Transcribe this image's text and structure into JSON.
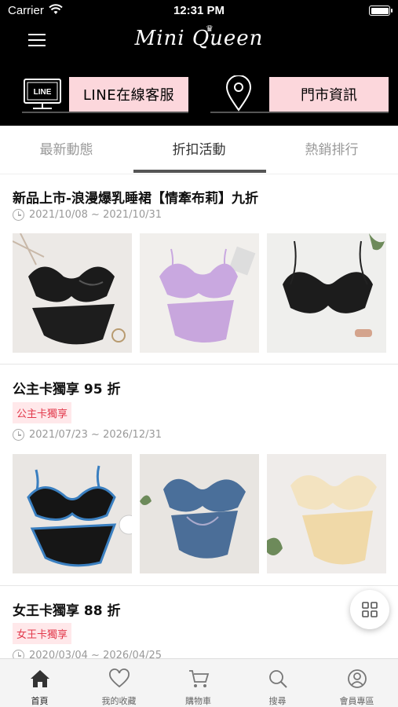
{
  "status_bar": {
    "carrier": "Carrier",
    "time": "12:31 PM"
  },
  "header": {
    "logo": "Mini Queen",
    "line_button": "LINE在線客服",
    "store_button": "門市資訊",
    "tv_label": "LINE"
  },
  "tabs": [
    {
      "label": "最新動態",
      "active": false
    },
    {
      "label": "折扣活動",
      "active": true
    },
    {
      "label": "熱銷排行",
      "active": false
    }
  ],
  "promos": [
    {
      "title": "新品上市-浪漫爆乳睡裙【情牽布莉】九折",
      "badge": "",
      "date": "2021/10/08 ~ 2021/10/31",
      "images": [
        "black lace bra set",
        "lavender bra set",
        "black lace bra"
      ]
    },
    {
      "title": "公主卡獨享 95 折",
      "badge": "公主卡獨享",
      "date": "2021/07/23 ~ 2026/12/31",
      "images": [
        "black and blue bra set",
        "blue lace bra set",
        "cream bra set"
      ]
    },
    {
      "title": "女王卡獨享 88 折",
      "badge": "女王卡獨享",
      "date": "2020/03/04 ~ 2026/04/25"
    }
  ],
  "bottom_nav": [
    {
      "label": "首頁",
      "icon": "home-icon",
      "active": true
    },
    {
      "label": "我的收藏",
      "icon": "heart-icon",
      "active": false
    },
    {
      "label": "購物車",
      "icon": "cart-icon",
      "active": false
    },
    {
      "label": "搜尋",
      "icon": "search-icon",
      "active": false
    },
    {
      "label": "會員專區",
      "icon": "user-icon",
      "active": false
    }
  ],
  "colors": {
    "accent_pink": "#fcd7dc",
    "badge_red": "#e2394b",
    "header_bg": "#000000"
  }
}
